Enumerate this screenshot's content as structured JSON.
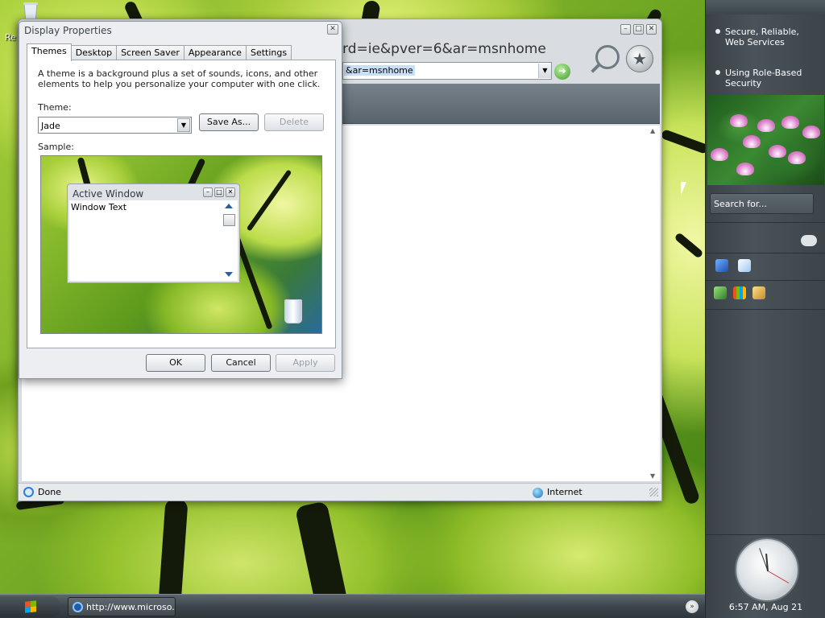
{
  "desktop": {
    "icon_label": "Re"
  },
  "ie": {
    "address_large": "rd=ie&pver=6&ar=msnhome",
    "address_selected": "&ar=msnhome",
    "status_done": "Done",
    "status_zone": "Internet"
  },
  "dialog": {
    "title": "Display Properties",
    "tabs": [
      "Themes",
      "Desktop",
      "Screen Saver",
      "Appearance",
      "Settings"
    ],
    "description": "A theme is a background plus a set of sounds, icons, and other elements to help you personalize your computer with one click.",
    "theme_label": "Theme:",
    "theme_value": "Jade",
    "save_as": "Save As...",
    "delete": "Delete",
    "sample_label": "Sample:",
    "preview": {
      "window_title": "Active Window",
      "window_text": "Window Text"
    },
    "ok": "OK",
    "cancel": "Cancel",
    "apply": "Apply"
  },
  "sidebar": {
    "links": [
      "Secure, Reliable, Web Services",
      "Using Role-Based Security"
    ],
    "search_placeholder": "Search for...",
    "clock_text": "6:57 AM, Aug 21"
  },
  "taskbar": {
    "task_label": "http://www.microso..."
  }
}
